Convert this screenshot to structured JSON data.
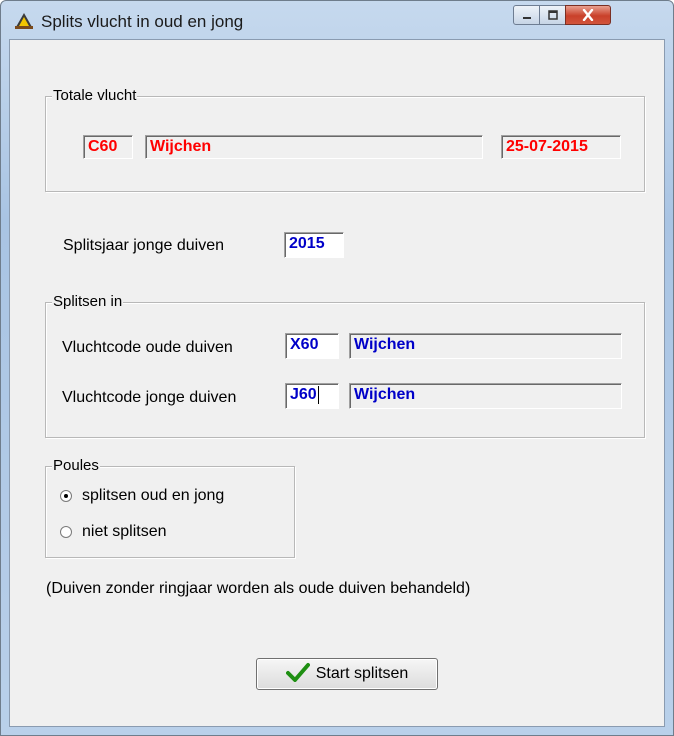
{
  "window": {
    "title": "Splits vlucht in oud en jong",
    "controls": {
      "minimize": "minimize-icon",
      "maximize": "maximize-icon",
      "close": "close-icon"
    }
  },
  "totale_vlucht": {
    "legend": "Totale vlucht",
    "code": "C60",
    "name": "Wijchen",
    "date": "25-07-2015"
  },
  "splitsjaar": {
    "label": "Splitsjaar jonge duiven",
    "value": "2015"
  },
  "splitsen_in": {
    "legend": "Splitsen in",
    "oude": {
      "label": "Vluchtcode oude duiven",
      "code": "X60",
      "name": "Wijchen"
    },
    "jonge": {
      "label": "Vluchtcode jonge duiven",
      "code": "J60",
      "name": "Wijchen"
    }
  },
  "poules": {
    "legend": "Poules",
    "options": [
      {
        "label": "splitsen oud en jong",
        "selected": true
      },
      {
        "label": "niet splitsen",
        "selected": false
      }
    ]
  },
  "note": "(Duiven zonder ringjaar worden als oude duiven behandeld)",
  "start_button": {
    "label": "Start splitsen",
    "icon": "checkmark-icon"
  },
  "colors": {
    "field_red": "#ff0000",
    "field_blue": "#0000c8",
    "dialog_bg": "#f0f0f0"
  }
}
